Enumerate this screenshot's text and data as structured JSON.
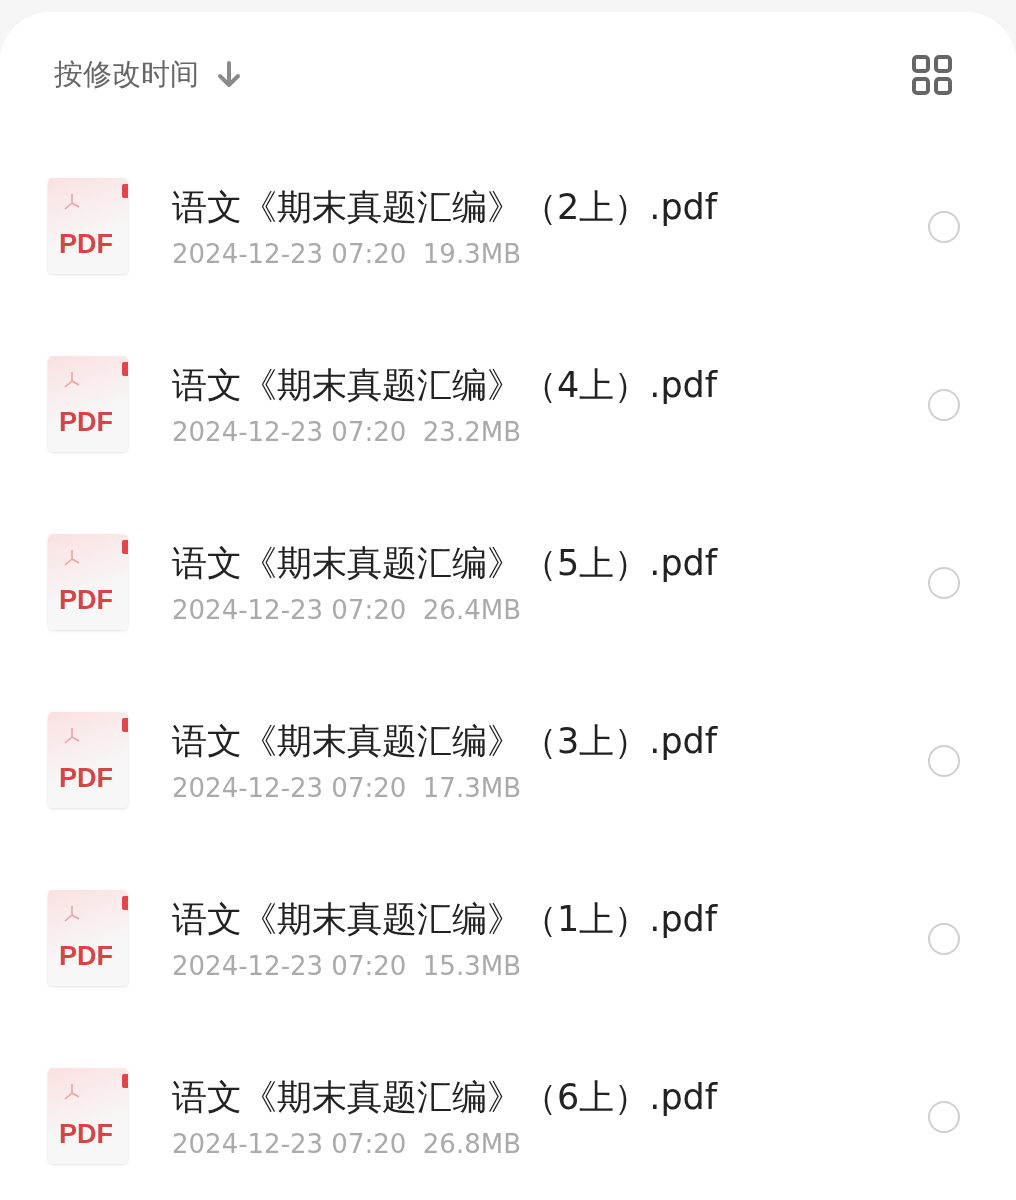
{
  "sort": {
    "label": "按修改时间"
  },
  "files": [
    {
      "name": "语文《期末真题汇编》（2上）.pdf",
      "badge": "PDF",
      "date": "2024-12-23 07:20",
      "size": "19.3MB",
      "selected": false
    },
    {
      "name": "语文《期末真题汇编》（4上）.pdf",
      "badge": "PDF",
      "date": "2024-12-23 07:20",
      "size": "23.2MB",
      "selected": false
    },
    {
      "name": "语文《期末真题汇编》（5上）.pdf",
      "badge": "PDF",
      "date": "2024-12-23 07:20",
      "size": "26.4MB",
      "selected": false
    },
    {
      "name": "语文《期末真题汇编》（3上）.pdf",
      "badge": "PDF",
      "date": "2024-12-23 07:20",
      "size": "17.3MB",
      "selected": false
    },
    {
      "name": "语文《期末真题汇编》（1上）.pdf",
      "badge": "PDF",
      "date": "2024-12-23 07:20",
      "size": "15.3MB",
      "selected": false
    },
    {
      "name": "语文《期末真题汇编》（6上）.pdf",
      "badge": "PDF",
      "date": "2024-12-23 07:20",
      "size": "26.8MB",
      "selected": false
    }
  ]
}
